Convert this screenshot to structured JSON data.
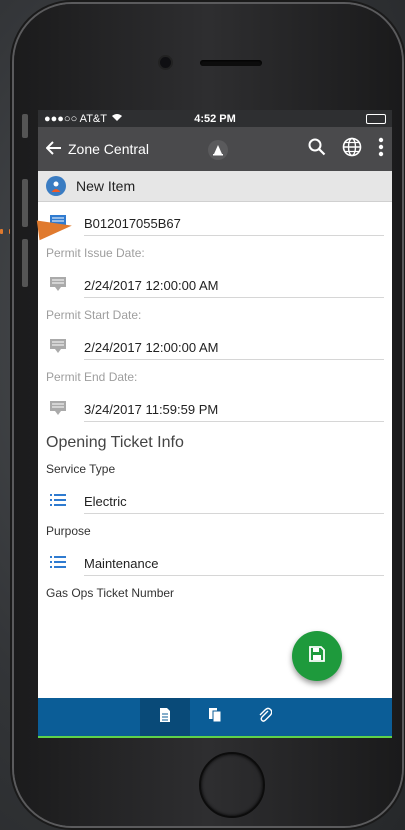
{
  "status_bar": {
    "carrier": "●●●○○ AT&T",
    "time": "4:52 PM"
  },
  "app_bar": {
    "title": "Zone Central"
  },
  "record": {
    "name": "New Item"
  },
  "form": {
    "permit_number": "B012017055B67",
    "issue_label": "Permit Issue Date:",
    "issue_value": "2/24/2017 12:00:00 AM",
    "start_label": "Permit Start Date:",
    "start_value": "2/24/2017 12:00:00 AM",
    "end_label": "Permit End Date:",
    "end_value": "3/24/2017 11:59:59 PM",
    "section_title": "Opening Ticket Info",
    "service_type_label": "Service Type",
    "service_type_value": "Electric",
    "purpose_label": "Purpose",
    "purpose_value": "Maintenance",
    "gas_ops_label": "Gas Ops Ticket Number"
  },
  "colors": {
    "accent_blue": "#2f7bd0",
    "nav_blue": "#0b5d97",
    "fab_green": "#1e9a3c",
    "pointer_orange": "#e07a2e"
  }
}
